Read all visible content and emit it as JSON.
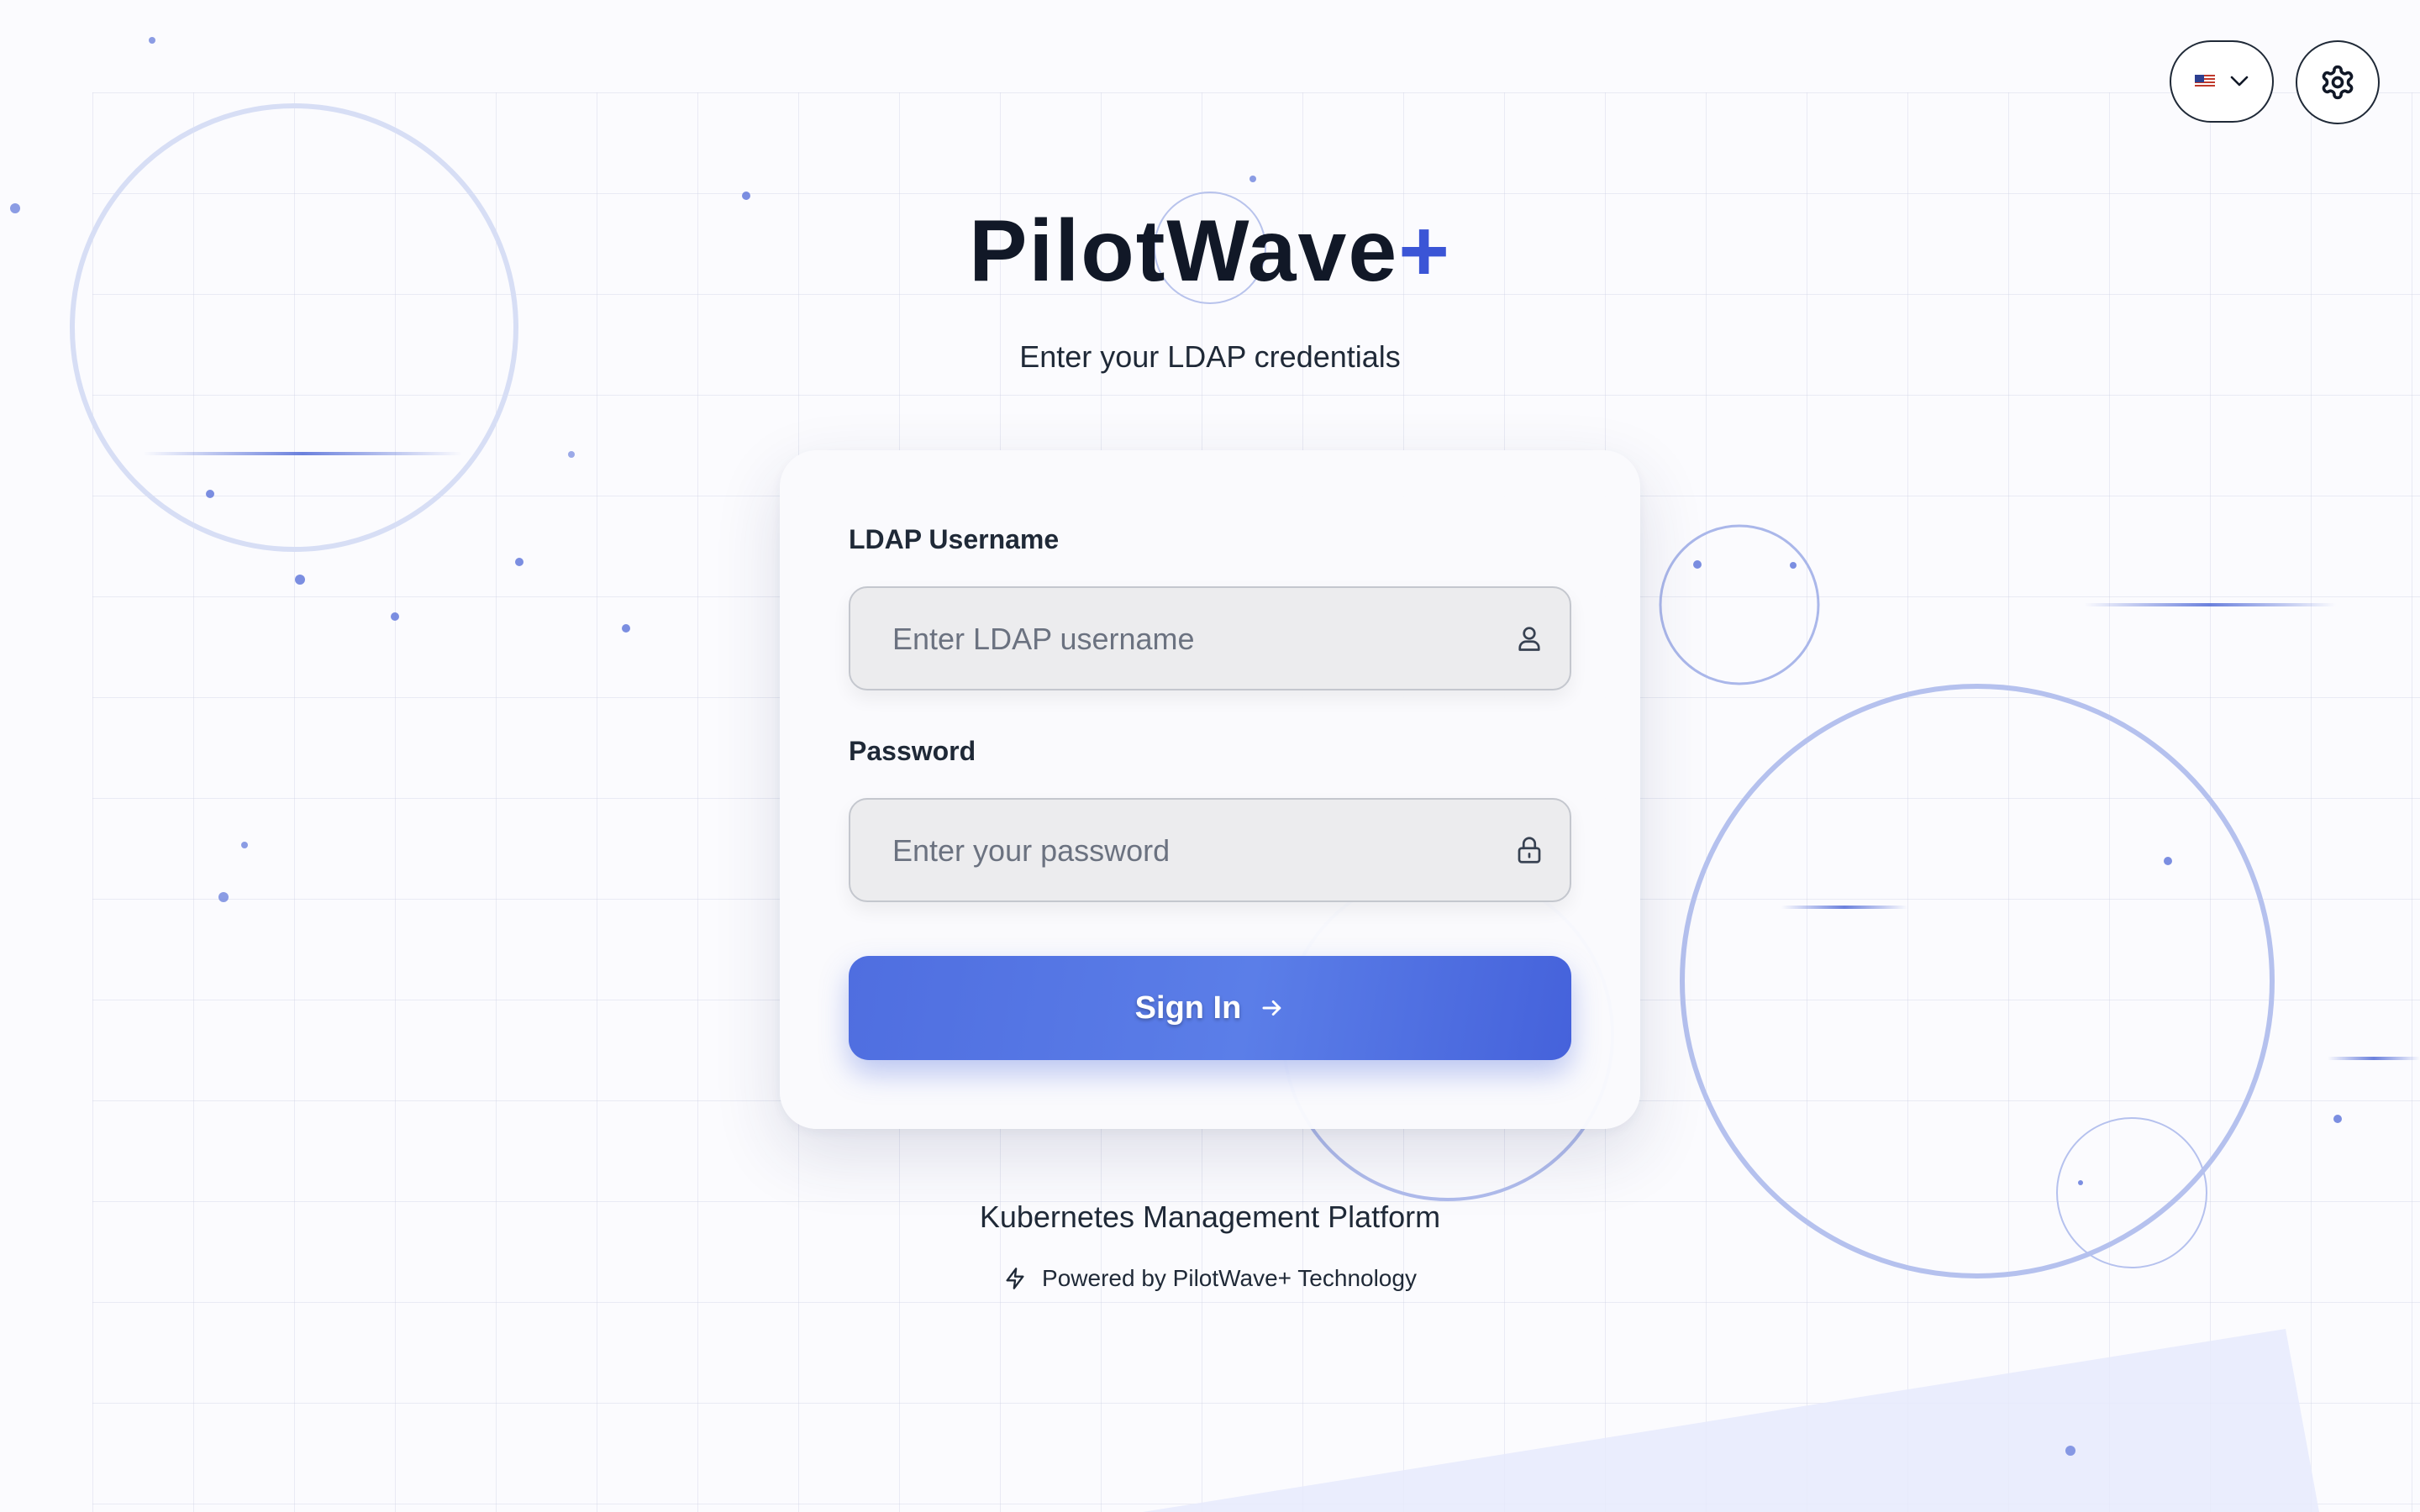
{
  "header": {
    "language_flag": "us-flag-icon",
    "language_chevron": "chevron-down-icon",
    "settings_icon": "gear-icon"
  },
  "brand": {
    "name": "PilotWave",
    "plus": "+",
    "accent_color": "#3b55d6"
  },
  "subtitle": "Enter your LDAP credentials",
  "form": {
    "username_label": "LDAP Username",
    "username_placeholder": "Enter LDAP username",
    "username_value": "",
    "username_icon": "user-icon",
    "password_label": "Password",
    "password_placeholder": "Enter your password",
    "password_value": "",
    "password_icon": "lock-icon",
    "submit_label": "Sign In",
    "submit_icon": "arrow-right-icon",
    "submit_color": "#4f6ee0"
  },
  "footer": {
    "platform": "Kubernetes Management Platform",
    "powered_by": "Powered by PilotWave+ Technology",
    "powered_icon": "lightning-icon"
  }
}
